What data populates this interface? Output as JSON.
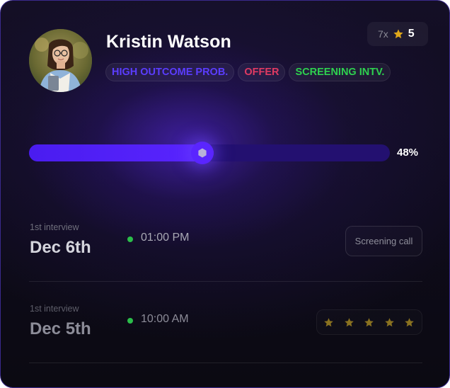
{
  "profile": {
    "name": "Kristin Watson",
    "tags": [
      {
        "label": "HIGH OUTCOME PROB.",
        "color": "#5b3dff"
      },
      {
        "label": "OFFER",
        "color": "#e03a63"
      },
      {
        "label": "SCREENING INTV.",
        "color": "#2ed14f"
      }
    ]
  },
  "rating": {
    "multiplier": "7x",
    "score": "5",
    "icon": "star-icon",
    "star_color": "#e0a81b"
  },
  "progress": {
    "fraction": 0.48,
    "label": "48%",
    "accent": "#5a25ff",
    "track_color": "#231070"
  },
  "interviews": [
    {
      "label": "1st interview",
      "date": "Dec 6th",
      "time": "01:00 PM",
      "status_color": "#2bbd4a",
      "action": "Screening call"
    },
    {
      "label": "1st interview",
      "date": "Dec 5th",
      "time": "10:00 AM",
      "status_color": "#2bbd4a",
      "stars": 5,
      "star_color": "#8a7220"
    }
  ]
}
